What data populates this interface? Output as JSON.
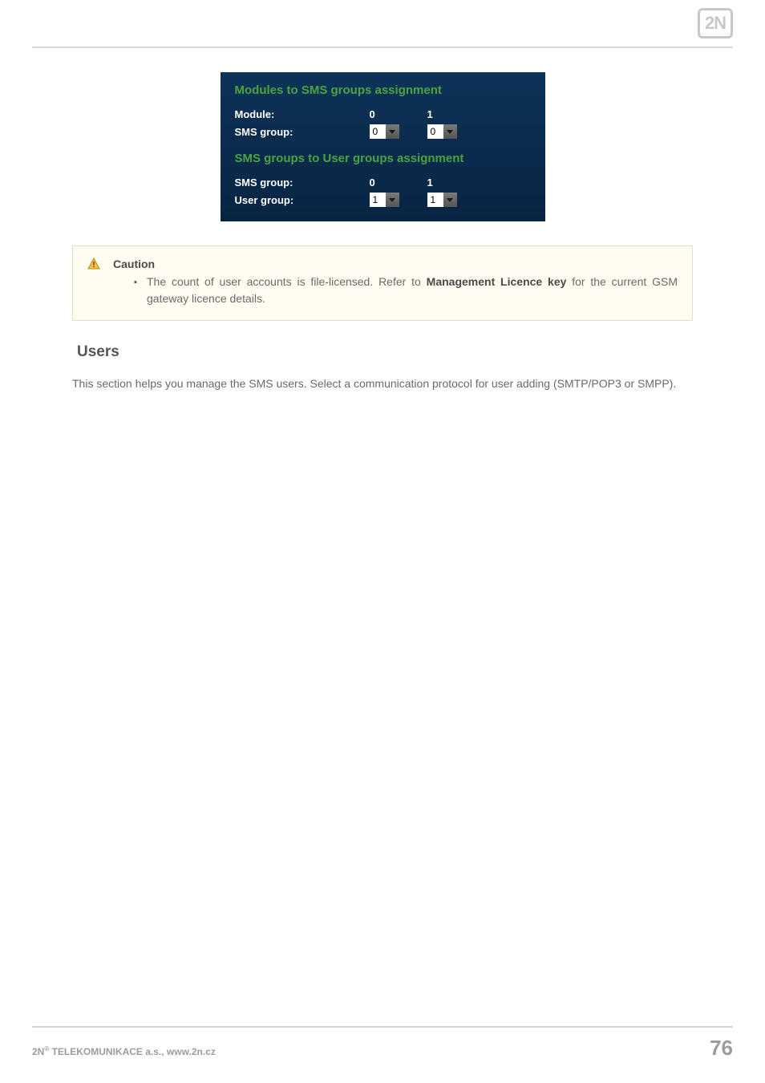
{
  "logo_text": "2N",
  "panel": {
    "heading1": "Modules to SMS groups assignment",
    "row1_label": "Module:",
    "row1_col0": "0",
    "row1_col1": "1",
    "row2_label": "SMS group:",
    "row2_val0": "0",
    "row2_val1": "0",
    "heading2": "SMS groups to User groups assignment",
    "row3_label": "SMS group:",
    "row3_col0": "0",
    "row3_col1": "1",
    "row4_label": "User group:",
    "row4_val0": "1",
    "row4_val1": "1"
  },
  "caution": {
    "title": "Caution",
    "text_pre": "The count of user accounts is file-licensed. Refer to ",
    "text_bold1": "Management Licence key",
    "text_post": " for the current GSM gateway licence details."
  },
  "section": {
    "title": "Users",
    "body": "This section helps you manage the SMS users. Select a communication protocol for user adding (SMTP/POP3 or SMPP)."
  },
  "footer": {
    "left_pre": "2N",
    "left_sup": "®",
    "left_post": " TELEKOMUNIKACE a.s., www.2n.cz",
    "page": "76"
  }
}
